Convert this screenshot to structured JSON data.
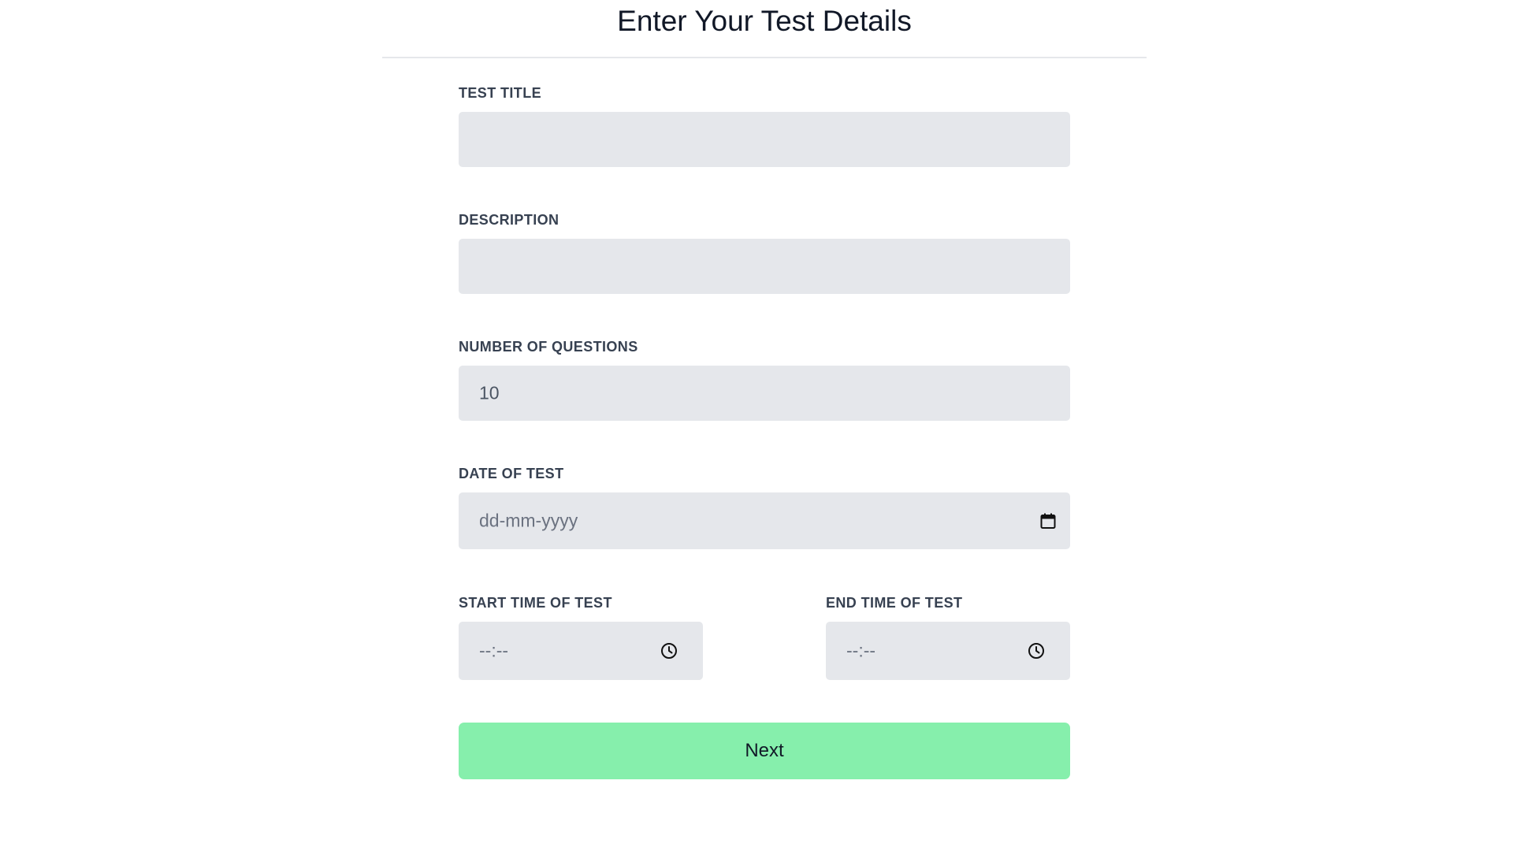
{
  "header": {
    "title": "Enter Your Test Details"
  },
  "form": {
    "test_title": {
      "label": "TEST TITLE",
      "value": ""
    },
    "description": {
      "label": "DESCRIPTION",
      "value": ""
    },
    "number_of_questions": {
      "label": "NUMBER OF QUESTIONS",
      "value": "10"
    },
    "date_of_test": {
      "label": "DATE OF TEST",
      "placeholder": "dd-mm-yyyy",
      "icon": "calendar-icon"
    },
    "start_time": {
      "label": "START TIME OF TEST",
      "placeholder": "--:--",
      "icon": "clock-icon"
    },
    "end_time": {
      "label": "END TIME OF TEST",
      "placeholder": "--:--",
      "icon": "clock-icon"
    },
    "next_label": "Next"
  },
  "colors": {
    "input_background": "#e5e7eb",
    "button_background": "#86efac",
    "label_text": "#374151"
  }
}
